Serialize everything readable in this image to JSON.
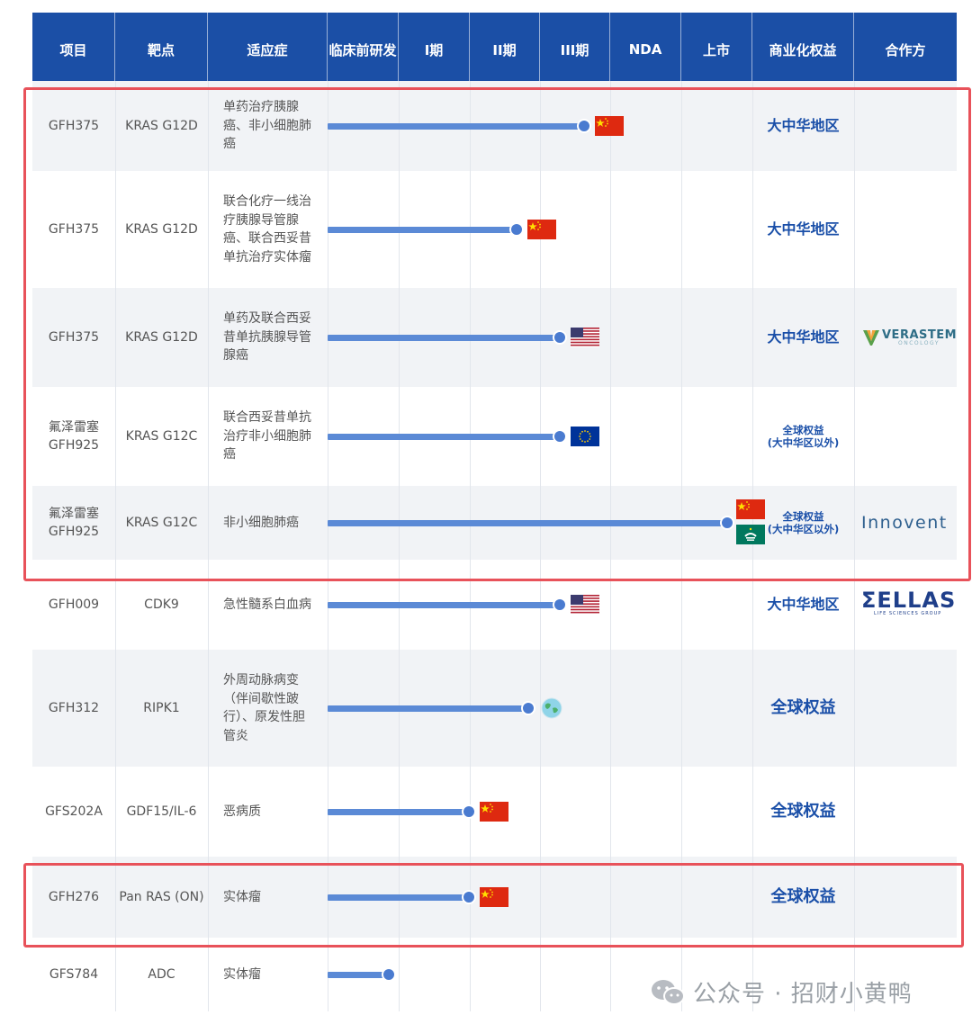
{
  "headers": [
    "项目",
    "靶点",
    "适应症",
    "临床前研发",
    "I期",
    "II期",
    "III期",
    "NDA",
    "上市",
    "商业化权益",
    "合作方"
  ],
  "rows": [
    {
      "project": "GFH375",
      "target": "KRAS G12D",
      "indication": [
        "单药治疗胰腺",
        "癌、非小细胞肺",
        "癌"
      ],
      "stage_progress": 0.64,
      "regions": [
        "china"
      ],
      "rights": "大中华地区",
      "partner": ""
    },
    {
      "project": "GFH375",
      "target": "KRAS G12D",
      "indication": [
        "联合化疗一线治",
        "疗胰腺导管腺",
        "癌、联合西妥昔",
        "单抗治疗实体瘤"
      ],
      "stage_progress": 0.47,
      "regions": [
        "china"
      ],
      "rights": "大中华地区",
      "partner": ""
    },
    {
      "project": "GFH375",
      "target": "KRAS G12D",
      "indication": [
        "单药及联合西妥",
        "昔单抗胰腺导管",
        "腺癌"
      ],
      "stage_progress": 0.58,
      "regions": [
        "usa"
      ],
      "rights": "大中华地区",
      "partner": "VERASTEM",
      "partner_sub": "ONCOLOGY"
    },
    {
      "project": [
        "氟泽雷塞",
        "GFH925"
      ],
      "target": "KRAS G12C",
      "indication": [
        "联合西妥昔单抗",
        "治疗非小细胞肺",
        "癌"
      ],
      "stage_progress": 0.58,
      "regions": [
        "eu"
      ],
      "rights": [
        "全球权益",
        "(大中华区以外)"
      ],
      "partner": ""
    },
    {
      "project": [
        "氟泽雷塞",
        "GFH925"
      ],
      "target": "KRAS G12C",
      "indication": [
        "非小细胞肺癌"
      ],
      "stage_progress": 1.0,
      "regions": [
        "china",
        "macau"
      ],
      "rights": [
        "全球权益",
        "(大中华区以外)"
      ],
      "partner": "Innovent"
    },
    {
      "project": "GFH009",
      "target": "CDK9",
      "indication": [
        "急性髓系白血病"
      ],
      "stage_progress": 0.58,
      "regions": [
        "usa"
      ],
      "rights": "大中华地区",
      "partner": "ΣELLAS",
      "partner_sub": "LIFE SCIENCES GROUP"
    },
    {
      "project": "GFH312",
      "target": "RIPK1",
      "indication": [
        "外周动脉病变",
        "（伴间歇性跛",
        "行）、原发性胆",
        "管炎"
      ],
      "stage_progress": 0.5,
      "regions": [
        "globe"
      ],
      "rights": "全球权益",
      "partner": ""
    },
    {
      "project": "GFS202A",
      "target": "GDF15/IL-6",
      "indication": [
        "恶病质"
      ],
      "stage_progress": 0.35,
      "regions": [
        "china"
      ],
      "rights": "全球权益",
      "partner": ""
    },
    {
      "project": "GFH276",
      "target": "Pan RAS (ON)",
      "indication": [
        "实体瘤"
      ],
      "stage_progress": 0.35,
      "regions": [
        "china"
      ],
      "rights": "全球权益",
      "partner": ""
    },
    {
      "project": "GFS784",
      "target": "ADC",
      "indication": [
        "实体瘤"
      ],
      "stage_progress": 0.15,
      "regions": [],
      "rights": "",
      "partner": ""
    }
  ],
  "watermark": "公众号 · 招财小黄鸭",
  "colors": {
    "header": "#1b4fa6",
    "bar": "#5b8ad6",
    "rights_text": "#1a4fa8",
    "highlight_box": "#e8525a"
  }
}
